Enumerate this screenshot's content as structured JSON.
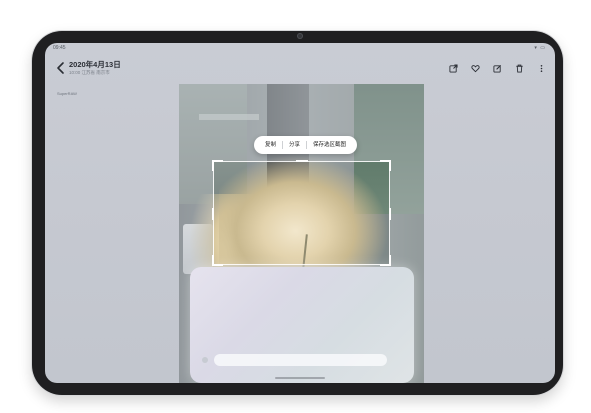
{
  "status_bar": {
    "time": "09:45",
    "icons": "▾ ▭"
  },
  "header": {
    "title": "2020年4月13日",
    "subtitle": "10:00 江苏省 南京市"
  },
  "watermark": "SuperRAW",
  "toolbar": {
    "icons": [
      "share-icon",
      "heart-icon",
      "edit-icon",
      "trash-icon",
      "more-icon"
    ]
  },
  "context_menu": {
    "items": [
      "复制",
      "分享",
      "保存选区截图"
    ]
  },
  "colors": {
    "screen_bg": "#c9ccd4",
    "menu_bg": "#ffffff",
    "device_frame": "#1f1f21"
  }
}
